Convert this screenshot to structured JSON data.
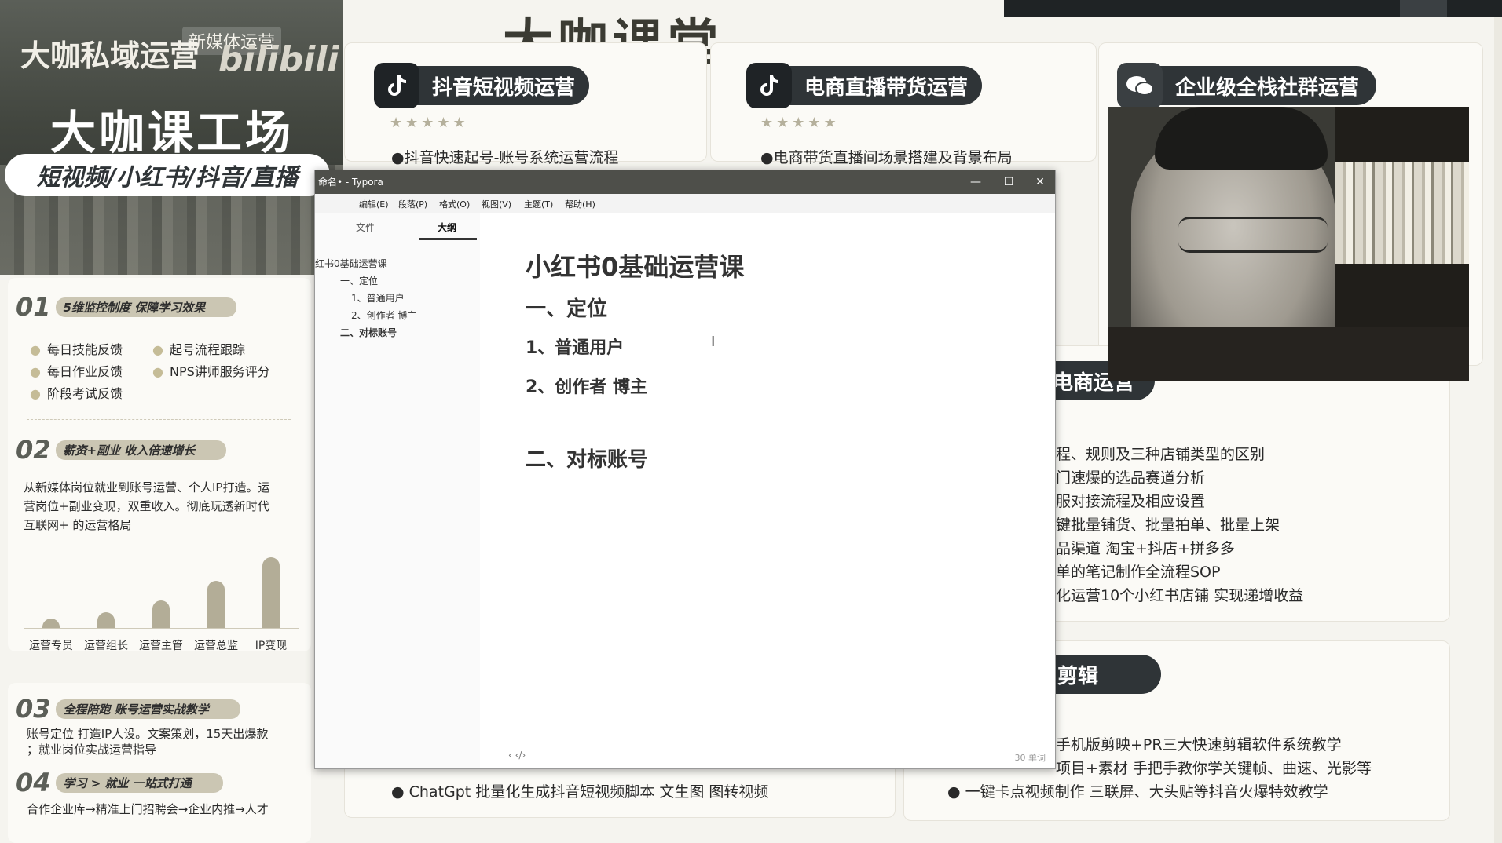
{
  "brand_title": "大咖课堂",
  "left_hero": {
    "line1": "大咖私域运营",
    "tag": "新媒体运营",
    "bili": "bilibili",
    "main_title": "大咖课工场",
    "subtitle": "短视频/小红书/抖音/直播"
  },
  "section1": {
    "num": "01",
    "label": "5维监控制度 保障学习效果",
    "items": [
      "每日技能反馈",
      "起号流程跟踪",
      "每日作业反馈",
      "NPS讲师服务评分",
      "阶段考试反馈"
    ]
  },
  "section2": {
    "num": "02",
    "label": "薪资+副业 收入倍速增长",
    "text_lines": [
      "从新媒体岗位就业到账号运营、个人IP打造。运",
      "营岗位+副业变现，双重收入。彻底玩透新时代",
      "互联网+ 的运营格局"
    ],
    "chart_data": {
      "type": "bar",
      "categories": [
        "运营专员",
        "运营组长",
        "运营主管",
        "运营总监",
        "IP变现"
      ],
      "values": [
        1,
        2,
        3.5,
        6,
        9
      ],
      "ylim": [
        0,
        10
      ]
    }
  },
  "section3": {
    "num": "03",
    "label": "全程陪跑 账号运营实战教学",
    "line1": "账号定位 打造IP人设。文案策划，15天出爆款",
    "line2": "；就业岗位实战运营指导"
  },
  "section4": {
    "num": "04",
    "label": "学习 > 就业 一站式打通",
    "line1": "合作企业库→精准上门招聘会→企业内推→人才"
  },
  "cards": {
    "douyin": {
      "title": "抖音短视频运营",
      "stars": "★★★★★",
      "bullet": "●抖音快速起号-账号系统运营流程"
    },
    "ecommerce": {
      "title": "电商直播带货运营",
      "stars": "★★★★★",
      "bullet": "●电商带货直播间场景搭建及背景布局"
    },
    "community": {
      "title": "企业级全栈社群运营"
    },
    "xhs_ecom": {
      "title_fragment": "电商运营",
      "bullets": [
        "程、规则及三种店铺类型的区别",
        "门速爆的选品赛道分析",
        "服对接流程及相应设置",
        "键批量铺货、批量拍单、批量上架",
        "品渠道 淘宝+抖店+拼多多",
        "单的笔记制作全流程SOP",
        "化运营10个小红书店铺 实现递增收益"
      ]
    },
    "editing": {
      "title_fragment": "剪辑",
      "bullets": [
        "手机版剪映+PR三大快速剪辑软件系统教学",
        "项目+素材 手把手教你学关键帧、曲速、光影等",
        "● 一键卡点视频制作 三联屏、大头贴等抖音火爆特效教学"
      ]
    },
    "chatgpt_bullet": "● ChatGpt 批量化生成抖音短视频脚本 文生图 图转视频"
  },
  "typora": {
    "window_title": "命名• - Typora",
    "menu": [
      "编辑(E)",
      "段落(P)",
      "格式(O)",
      "视图(V)",
      "主题(T)",
      "帮助(H)"
    ],
    "sidebar_tabs": [
      "文件",
      "大纲"
    ],
    "outline": [
      "红书0基础运营课",
      "一、定位",
      "1、普通用户",
      "2、创作者 博主",
      "二、对标账号"
    ],
    "doc": {
      "h1": "小红书0基础运营课",
      "h2_1": "一、定位",
      "h3_1": "1、普通用户",
      "h3_2": "2、创作者 博主",
      "h2_2": "二、对标账号"
    },
    "footer_nav": "‹   ‹/›",
    "wordcount": "30 单词"
  }
}
